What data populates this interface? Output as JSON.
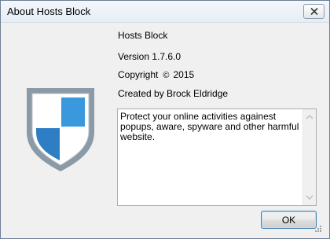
{
  "window": {
    "title": "About Hosts Block",
    "close_icon": "close-icon"
  },
  "app": {
    "name": "Hosts Block",
    "version": "Version 1.7.6.0",
    "copyright_label": "Copyright",
    "copyright_symbol": "©",
    "copyright_year": "2015",
    "author": "Created by Brock Eldridge",
    "logo_icon": "shield-icon",
    "logo_colors": {
      "border": "#8a9aa6",
      "blue_top": "#3a98dc",
      "blue_bottom": "#2e7ec4",
      "white": "#ffffff"
    }
  },
  "description": {
    "text": "Protect your online activities againest popups, aware, spyware and other harmful website."
  },
  "buttons": {
    "ok_label": "OK"
  }
}
